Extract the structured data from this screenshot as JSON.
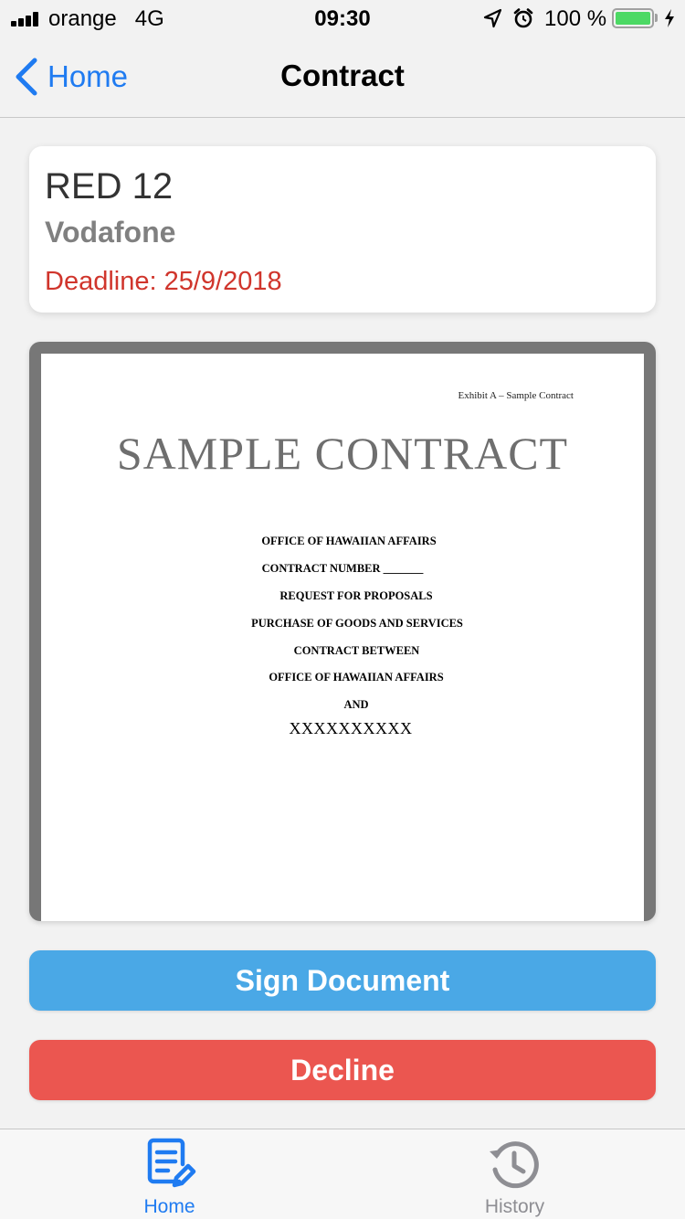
{
  "status_bar": {
    "carrier": "orange",
    "network": "4G",
    "time": "09:30",
    "battery_percent": "100 %",
    "battery_level": 1.0,
    "battery_color": "#4cd964",
    "icons": [
      "signal-icon",
      "location-arrow-icon",
      "alarm-clock-icon",
      "battery-icon",
      "charging-bolt-icon"
    ]
  },
  "nav": {
    "back_label": "Home",
    "title": "Contract",
    "accent_color": "#1f7bf1"
  },
  "card": {
    "title": "RED 12",
    "subtitle": "Vodafone",
    "deadline": "Deadline: 25/9/2018",
    "deadline_color": "#d0352c"
  },
  "document": {
    "exhibit": "Exhibit A – Sample Contract",
    "title": "SAMPLE CONTRACT",
    "lines": [
      "OFFICE OF HAWAIIAN AFFAIRS",
      "CONTRACT NUMBER _______",
      "REQUEST FOR PROPOSALS",
      "PURCHASE OF GOODS AND SERVICES",
      "CONTRACT BETWEEN",
      "OFFICE OF HAWAIIAN AFFAIRS",
      "AND",
      "XXXXXXXXXX"
    ]
  },
  "actions": {
    "sign_label": "Sign Document",
    "sign_color": "#4aa8e6",
    "decline_label": "Decline",
    "decline_color": "#eb5650"
  },
  "tabs": [
    {
      "label": "Home",
      "icon": "document-edit-icon",
      "selected": true
    },
    {
      "label": "History",
      "icon": "history-icon",
      "selected": false
    }
  ]
}
